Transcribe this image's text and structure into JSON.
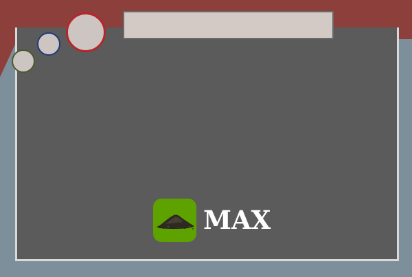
{
  "window": {
    "address_bar_value": ""
  },
  "logo": {
    "brand_text": "MAX",
    "icon_name": "soil-pile-icon",
    "icon_color": "#5ea200"
  },
  "colors": {
    "frame": "#8c3f3b",
    "background": "#7d8f9b",
    "screen": "#5b5b5b",
    "large_button_ring": "#b7262a",
    "medium_button_ring": "#1f3a78",
    "small_button_ring": "#4a5a2a"
  }
}
